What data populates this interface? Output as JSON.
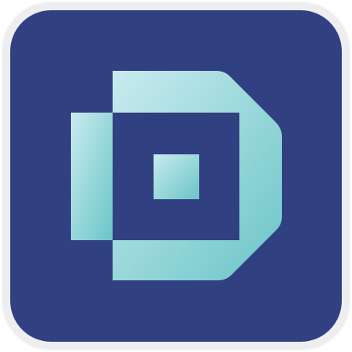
{
  "app_icon": {
    "icon_name": "d-monogram-logo-icon",
    "background_color": "#304080",
    "frame_color": "#edeef0",
    "logo_gradient": {
      "from": "#c9ebef",
      "to": "#6bc5c7"
    }
  }
}
